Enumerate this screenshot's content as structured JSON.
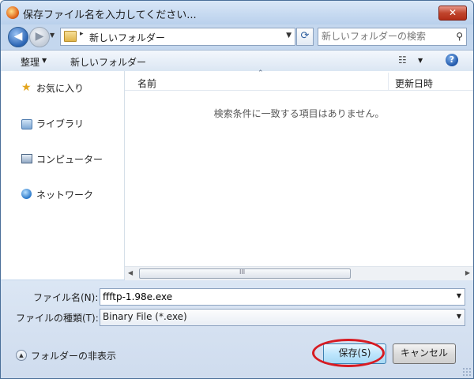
{
  "window": {
    "title": "保存ファイル名を入力してください...",
    "close_label": "✕"
  },
  "nav": {
    "back_label": "◀",
    "forward_label": "▶",
    "address": {
      "current_folder": "新しいフォルダー",
      "separator": "▸"
    },
    "refresh_label": "⟳",
    "search": {
      "placeholder": "新しいフォルダーの検索"
    }
  },
  "toolbar": {
    "organize_label": "整理",
    "new_folder_label": "新しいフォルダー",
    "view_label": "☷",
    "help_label": "?"
  },
  "sidebar": {
    "items": [
      {
        "label": "お気に入り",
        "icon": "star-icon"
      },
      {
        "label": "ライブラリ",
        "icon": "library-icon"
      },
      {
        "label": "コンピューター",
        "icon": "computer-icon"
      },
      {
        "label": "ネットワーク",
        "icon": "network-icon"
      }
    ]
  },
  "filelist": {
    "columns": {
      "name": "名前",
      "date": "更新日時"
    },
    "empty_message": "検索条件に一致する項目はありません。",
    "scroll_grip": "III"
  },
  "form": {
    "filename_label": "ファイル名(N):",
    "filename_value": "ffftp-1.98e.exe",
    "filetype_label": "ファイルの種類(T):",
    "filetype_value": "Binary File (*.exe)",
    "hide_folders_label": "フォルダーの非表示",
    "save_label": "保存(S)",
    "cancel_label": "キャンセル"
  },
  "colors": {
    "accent": "#3c7fb1",
    "highlight_circle": "#d71b22",
    "chrome": "#c4d7ee"
  }
}
